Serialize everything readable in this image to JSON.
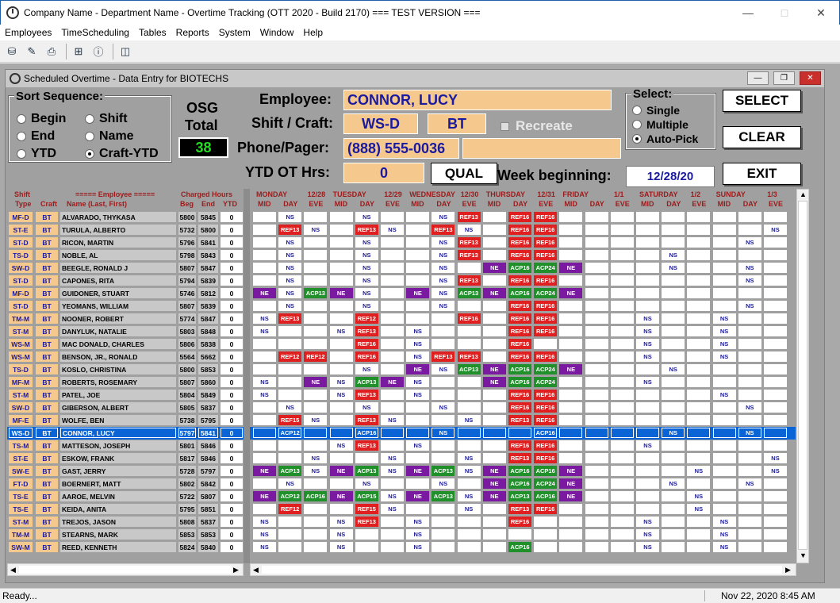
{
  "window": {
    "title": "Company Name - Department Name - Overtime Tracking (OTT 2020 - Build 2170)  === TEST VERSION ==="
  },
  "menu": [
    "Employees",
    "TimeScheduling",
    "Tables",
    "Reports",
    "System",
    "Window",
    "Help"
  ],
  "child": {
    "title": "Scheduled Overtime - Data Entry for BIOTECHS"
  },
  "sort": {
    "legend": "Sort Sequence:",
    "options": [
      "Begin",
      "Shift",
      "End",
      "Name",
      "YTD",
      "Craft-YTD"
    ],
    "selected": "Craft-YTD"
  },
  "osg": {
    "label1": "OSG",
    "label2": "Total",
    "value": "38"
  },
  "employee": {
    "label": "Employee:",
    "value": "CONNOR, LUCY"
  },
  "shift": {
    "label": "Shift / Craft:",
    "shift": "WS-D",
    "craft": "BT",
    "recreate": "Recreate"
  },
  "phone": {
    "label": "Phone/Pager:",
    "value": "(888) 555-0036",
    "value2": ""
  },
  "ytd": {
    "label": "YTD OT Hrs:",
    "value": "0"
  },
  "qual": "QUAL",
  "week": {
    "label": "Week beginning:",
    "value": "12/28/20"
  },
  "select": {
    "legend": "Select:",
    "options": [
      "Single",
      "Multiple",
      "Auto-Pick"
    ],
    "selected": "Auto-Pick"
  },
  "buttons": {
    "select": "SELECT",
    "clear": "CLEAR",
    "exit": "EXIT"
  },
  "leftheaders": {
    "shift": "Shift",
    "type": "Type",
    "craft": "Craft",
    "employee": "===== Employee =====",
    "name": "Name (Last, First)",
    "charged": "Charged Hours",
    "beg": "Beg",
    "end": "End",
    "ytd": "YTD"
  },
  "days": [
    {
      "name": "MONDAY",
      "date": "12/28"
    },
    {
      "name": "TUESDAY",
      "date": "12/29"
    },
    {
      "name": "WEDNESDAY",
      "date": "12/30"
    },
    {
      "name": "THURSDAY",
      "date": "12/31"
    },
    {
      "name": "FRIDAY",
      "date": "1/1"
    },
    {
      "name": "SATURDAY",
      "date": "1/2"
    },
    {
      "name": "SUNDAY",
      "date": "1/3"
    }
  ],
  "subheads": [
    "MID",
    "DAY",
    "EVE"
  ],
  "rows": [
    {
      "st": "MF-D",
      "cf": "BT",
      "name": "ALVARADO, THYKASA",
      "beg": "5800",
      "end": "5845",
      "ytd": "0",
      "c": [
        "",
        "NS",
        "",
        "",
        "NS",
        "",
        "",
        "NS",
        "REF13",
        "",
        "REF16",
        "REF16",
        "",
        "",
        "",
        "",
        "",
        "",
        "",
        "",
        ""
      ]
    },
    {
      "st": "ST-E",
      "cf": "BT",
      "name": "TURULA, ALBERTO",
      "beg": "5732",
      "end": "5800",
      "ytd": "0",
      "c": [
        "",
        "REF13",
        "NS",
        "",
        "REF13",
        "NS",
        "",
        "REF13",
        "NS",
        "",
        "REF16",
        "REF16",
        "",
        "",
        "",
        "",
        "",
        "",
        "",
        "",
        "NS"
      ]
    },
    {
      "st": "ST-D",
      "cf": "BT",
      "name": "RICON, MARTIN",
      "beg": "5796",
      "end": "5841",
      "ytd": "0",
      "c": [
        "",
        "NS",
        "",
        "",
        "NS",
        "",
        "",
        "NS",
        "REF13",
        "",
        "REF16",
        "REF16",
        "",
        "",
        "",
        "",
        "",
        "",
        "",
        "NS",
        ""
      ]
    },
    {
      "st": "TS-D",
      "cf": "BT",
      "name": "NOBLE, AL",
      "beg": "5798",
      "end": "5843",
      "ytd": "0",
      "c": [
        "",
        "NS",
        "",
        "",
        "NS",
        "",
        "",
        "NS",
        "REF13",
        "",
        "REF16",
        "REF16",
        "",
        "",
        "",
        "",
        "NS",
        "",
        "",
        "",
        ""
      ]
    },
    {
      "st": "SW-D",
      "cf": "BT",
      "name": "BEEGLE, RONALD J",
      "beg": "5807",
      "end": "5847",
      "ytd": "0",
      "c": [
        "",
        "NS",
        "",
        "",
        "NS",
        "",
        "",
        "NS",
        "",
        "NE",
        "ACP16",
        "ACP24",
        "NE",
        "",
        "",
        "",
        "NS",
        "",
        "",
        "NS",
        ""
      ]
    },
    {
      "st": "ST-D",
      "cf": "BT",
      "name": "CAPONES, RITA",
      "beg": "5794",
      "end": "5839",
      "ytd": "0",
      "c": [
        "",
        "NS",
        "",
        "",
        "NS",
        "",
        "",
        "NS",
        "REF13",
        "",
        "REF16",
        "REF16",
        "",
        "",
        "",
        "",
        "",
        "",
        "",
        "NS",
        ""
      ]
    },
    {
      "st": "MF-D",
      "cf": "BT",
      "name": "GUIDONER, STUART",
      "beg": "5746",
      "end": "5812",
      "ytd": "0",
      "c": [
        "NE",
        "NS",
        "ACP13",
        "NE",
        "NS",
        "",
        "NE",
        "NS",
        "ACP13",
        "NE",
        "ACP16",
        "ACP24",
        "NE",
        "",
        "",
        "",
        "",
        "",
        "",
        "",
        ""
      ]
    },
    {
      "st": "ST-D",
      "cf": "BT",
      "name": "YEOMANS, WILLIAM",
      "beg": "5807",
      "end": "5839",
      "ytd": "0",
      "c": [
        "",
        "NS",
        "",
        "",
        "NS",
        "",
        "",
        "NS",
        "",
        "",
        "REF16",
        "REF16",
        "",
        "",
        "",
        "",
        "",
        "",
        "",
        "NS",
        ""
      ]
    },
    {
      "st": "TM-M",
      "cf": "BT",
      "name": "NOONER, ROBERT",
      "beg": "5774",
      "end": "5847",
      "ytd": "0",
      "c": [
        "NS",
        "REF13",
        "",
        "",
        "REF12",
        "",
        "",
        "",
        "REF16",
        "",
        "REF16",
        "REF16",
        "",
        "",
        "",
        "NS",
        "",
        "",
        "NS",
        "",
        ""
      ]
    },
    {
      "st": "ST-M",
      "cf": "BT",
      "name": "DANYLUK, NATALIE",
      "beg": "5803",
      "end": "5848",
      "ytd": "0",
      "c": [
        "NS",
        "",
        "",
        "NS",
        "REF13",
        "",
        "NS",
        "",
        "",
        "",
        "REF16",
        "REF16",
        "",
        "",
        "",
        "NS",
        "",
        "",
        "NS",
        "",
        ""
      ]
    },
    {
      "st": "WS-M",
      "cf": "BT",
      "name": "MAC DONALD, CHARLES",
      "beg": "5806",
      "end": "5838",
      "ytd": "0",
      "c": [
        "",
        "",
        "",
        "",
        "REF16",
        "",
        "NS",
        "",
        "",
        "",
        "REF16",
        "",
        "",
        "",
        "",
        "NS",
        "",
        "",
        "NS",
        "",
        ""
      ]
    },
    {
      "st": "WS-M",
      "cf": "BT",
      "name": "BENSON, JR., RONALD",
      "beg": "5564",
      "end": "5662",
      "ytd": "0",
      "c": [
        "",
        "REF12",
        "REF12",
        "",
        "REF16",
        "",
        "NS",
        "REF13",
        "REF13",
        "",
        "REF16",
        "REF16",
        "",
        "",
        "",
        "NS",
        "",
        "",
        "NS",
        "",
        ""
      ]
    },
    {
      "st": "TS-D",
      "cf": "BT",
      "name": "KOSLO, CHRISTINA",
      "beg": "5800",
      "end": "5853",
      "ytd": "0",
      "c": [
        "",
        "",
        "",
        "",
        "NS",
        "",
        "NE",
        "NS",
        "ACP13",
        "NE",
        "ACP16",
        "ACP24",
        "NE",
        "",
        "",
        "",
        "NS",
        "",
        "",
        "",
        ""
      ]
    },
    {
      "st": "MF-M",
      "cf": "BT",
      "name": "ROBERTS, ROSEMARY",
      "beg": "5807",
      "end": "5860",
      "ytd": "0",
      "c": [
        "NS",
        "",
        "NE",
        "NS",
        "ACP13",
        "NE",
        "NS",
        "",
        "",
        "NE",
        "ACP16",
        "ACP24",
        "",
        "",
        "",
        "NS",
        "",
        "",
        "",
        "",
        ""
      ]
    },
    {
      "st": "ST-M",
      "cf": "BT",
      "name": "PATEL, JOE",
      "beg": "5804",
      "end": "5849",
      "ytd": "0",
      "c": [
        "NS",
        "",
        "",
        "NS",
        "REF13",
        "",
        "NS",
        "",
        "",
        "",
        "REF16",
        "REF16",
        "",
        "",
        "",
        "",
        "",
        "",
        "NS",
        "",
        ""
      ]
    },
    {
      "st": "SW-D",
      "cf": "BT",
      "name": "GIBERSON, ALBERT",
      "beg": "5805",
      "end": "5837",
      "ytd": "0",
      "c": [
        "",
        "NS",
        "",
        "",
        "NS",
        "",
        "",
        "NS",
        "",
        "",
        "REF16",
        "REF16",
        "",
        "",
        "",
        "",
        "",
        "",
        "",
        "NS",
        ""
      ]
    },
    {
      "st": "MF-E",
      "cf": "BT",
      "name": "WOLFE, BEN",
      "beg": "5738",
      "end": "5795",
      "ytd": "0",
      "c": [
        "",
        "REF15",
        "NS",
        "",
        "REF13",
        "NS",
        "",
        "",
        "NS",
        "",
        "REF13",
        "REF16",
        "",
        "",
        "",
        "",
        "",
        "",
        "",
        "",
        ""
      ]
    },
    {
      "st": "WS-D",
      "cf": "BT",
      "name": "CONNOR, LUCY",
      "beg": "5797",
      "end": "5841",
      "ytd": "0",
      "sel": true,
      "c": [
        "",
        "ACP12",
        "",
        "",
        "ACP16",
        "",
        "",
        "NS",
        "",
        "",
        "",
        "ACP16",
        "",
        "",
        "",
        "",
        "NS",
        "",
        "",
        "NS",
        ""
      ]
    },
    {
      "st": "TS-M",
      "cf": "BT",
      "name": "MATTESON, JOSEPH",
      "beg": "5801",
      "end": "5846",
      "ytd": "0",
      "c": [
        "",
        "",
        "",
        "NS",
        "REF13",
        "",
        "NS",
        "",
        "",
        "",
        "REF16",
        "REF16",
        "",
        "",
        "",
        "NS",
        "",
        "",
        "",
        "",
        ""
      ]
    },
    {
      "st": "ST-E",
      "cf": "BT",
      "name": "ESKOW, FRANK",
      "beg": "5817",
      "end": "5846",
      "ytd": "0",
      "c": [
        "",
        "",
        "NS",
        "",
        "",
        "NS",
        "",
        "",
        "NS",
        "",
        "REF13",
        "REF16",
        "",
        "",
        "",
        "",
        "",
        "",
        "",
        "",
        "NS"
      ]
    },
    {
      "st": "SW-E",
      "cf": "BT",
      "name": "GAST, JERRY",
      "beg": "5728",
      "end": "5797",
      "ytd": "0",
      "c": [
        "NE",
        "ACP13",
        "NS",
        "NE",
        "ACP13",
        "NS",
        "NE",
        "ACP13",
        "NS",
        "NE",
        "ACP16",
        "ACP16",
        "NE",
        "",
        "",
        "",
        "",
        "NS",
        "",
        "",
        "NS"
      ]
    },
    {
      "st": "FT-D",
      "cf": "BT",
      "name": "BOERNERT, MATT",
      "beg": "5802",
      "end": "5842",
      "ytd": "0",
      "c": [
        "",
        "NS",
        "",
        "",
        "NS",
        "",
        "",
        "NS",
        "",
        "NE",
        "ACP16",
        "ACP24",
        "NE",
        "",
        "",
        "",
        "NS",
        "",
        "",
        "NS",
        ""
      ]
    },
    {
      "st": "TS-E",
      "cf": "BT",
      "name": "AAROE, MELVIN",
      "beg": "5722",
      "end": "5807",
      "ytd": "0",
      "c": [
        "NE",
        "ACP12",
        "ACP16",
        "NE",
        "ACP15",
        "NS",
        "NE",
        "ACP13",
        "NS",
        "NE",
        "ACP13",
        "ACP16",
        "NE",
        "",
        "",
        "",
        "",
        "NS",
        "",
        "",
        ""
      ]
    },
    {
      "st": "TS-E",
      "cf": "BT",
      "name": "KEIDA, ANITA",
      "beg": "5795",
      "end": "5851",
      "ytd": "0",
      "c": [
        "",
        "REF12",
        "",
        "",
        "REF15",
        "NS",
        "",
        "",
        "NS",
        "",
        "REF13",
        "REF16",
        "",
        "",
        "",
        "",
        "",
        "NS",
        "",
        "",
        ""
      ]
    },
    {
      "st": "ST-M",
      "cf": "BT",
      "name": "TREJOS, JASON",
      "beg": "5808",
      "end": "5837",
      "ytd": "0",
      "c": [
        "NS",
        "",
        "",
        "NS",
        "REF13",
        "",
        "NS",
        "",
        "",
        "",
        "REF16",
        "",
        "",
        "",
        "",
        "NS",
        "",
        "",
        "NS",
        "",
        ""
      ]
    },
    {
      "st": "TM-M",
      "cf": "BT",
      "name": "STEARNS, MARK",
      "beg": "5853",
      "end": "5853",
      "ytd": "0",
      "c": [
        "NS",
        "",
        "",
        "NS",
        "",
        "",
        "NS",
        "",
        "",
        "",
        "",
        "",
        "",
        "",
        "",
        "NS",
        "",
        "",
        "NS",
        "",
        ""
      ]
    },
    {
      "st": "SW-M",
      "cf": "BT",
      "name": "REED, KENNETH",
      "beg": "5824",
      "end": "5840",
      "ytd": "0",
      "c": [
        "NS",
        "",
        "",
        "NS",
        "",
        "",
        "NS",
        "",
        "",
        "",
        "ACP16",
        "",
        "",
        "",
        "",
        "NS",
        "",
        "",
        "NS",
        "",
        ""
      ]
    }
  ],
  "status": {
    "left": "Ready...",
    "right": "Nov 22, 2020   8:45 AM"
  }
}
